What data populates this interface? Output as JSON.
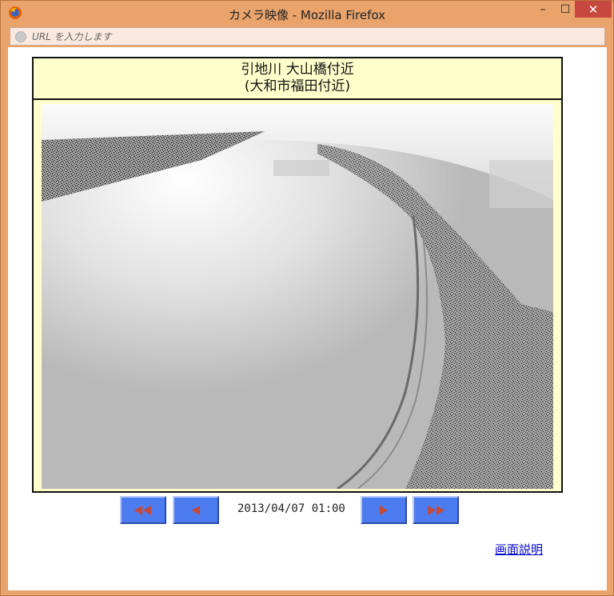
{
  "window": {
    "title": "カメラ映像 - Mozilla Firefox",
    "app_icon": "firefox-icon",
    "controls": {
      "minimize": "–",
      "maximize": "☐",
      "close": "✕"
    }
  },
  "urlbar": {
    "placeholder": "URL を入力します",
    "value": ""
  },
  "camera": {
    "location_line1": "引地川 大山橋付近",
    "location_line2": "(大和市福田付近)",
    "timestamp": "2013/04/07 01:00"
  },
  "navigation": {
    "first_icon": "double-left-arrow-icon",
    "prev_icon": "left-arrow-icon",
    "next_icon": "right-arrow-icon",
    "last_icon": "double-right-arrow-icon"
  },
  "help_link": "画面説明",
  "colors": {
    "frame_accent": "#e9a36b",
    "close_button": "#c7483f",
    "nav_button": "#4c7cf0",
    "header_bg": "#ffffcc",
    "link": "#0000cc"
  }
}
